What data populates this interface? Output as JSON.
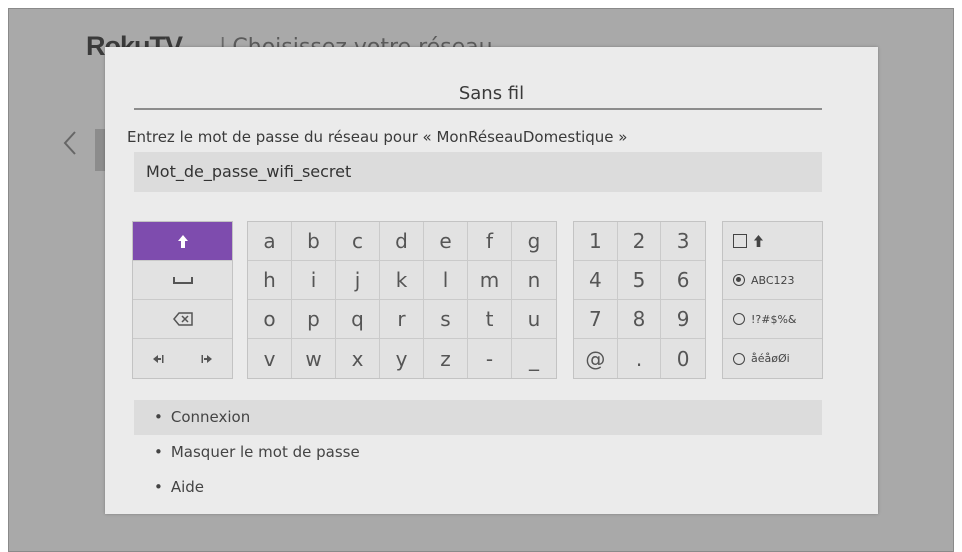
{
  "background": {
    "logo": "RokuTV",
    "separator": "|",
    "title": "Choisissez votre réseau"
  },
  "modal": {
    "title": "Sans fil",
    "prompt": "Entrez le mot de passe du réseau pour « MonRéseauDomestique »",
    "password_value": "Mot_de_passe_wifi_secret"
  },
  "keyboard": {
    "function_keys": [
      {
        "name": "shift",
        "icon": "shift-arrow-icon"
      },
      {
        "name": "space",
        "icon": "space-icon"
      },
      {
        "name": "backspace",
        "icon": "backspace-icon"
      },
      {
        "name": "cursor-left",
        "icon": "cursor-left-icon"
      },
      {
        "name": "cursor-right",
        "icon": "cursor-right-icon"
      }
    ],
    "letters": [
      "a",
      "b",
      "c",
      "d",
      "e",
      "f",
      "g",
      "h",
      "i",
      "j",
      "k",
      "l",
      "m",
      "n",
      "o",
      "p",
      "q",
      "r",
      "s",
      "t",
      "u",
      "v",
      "w",
      "x",
      "y",
      "z",
      "-",
      "_"
    ],
    "digits": [
      "1",
      "2",
      "3",
      "4",
      "5",
      "6",
      "7",
      "8",
      "9",
      "@",
      ".",
      "0"
    ],
    "modes": [
      {
        "label": "",
        "type": "caps-lock"
      },
      {
        "label": "ABC123",
        "type": "radio",
        "selected": true
      },
      {
        "label": "!?#$%&",
        "type": "radio",
        "selected": false
      },
      {
        "label": "åéåøØi",
        "type": "radio",
        "selected": false
      }
    ],
    "selected_color": "#7e4cae"
  },
  "options": [
    {
      "label": "Connexion",
      "focused": true
    },
    {
      "label": "Masquer le mot de passe",
      "focused": false
    },
    {
      "label": "Aide",
      "focused": false
    }
  ]
}
